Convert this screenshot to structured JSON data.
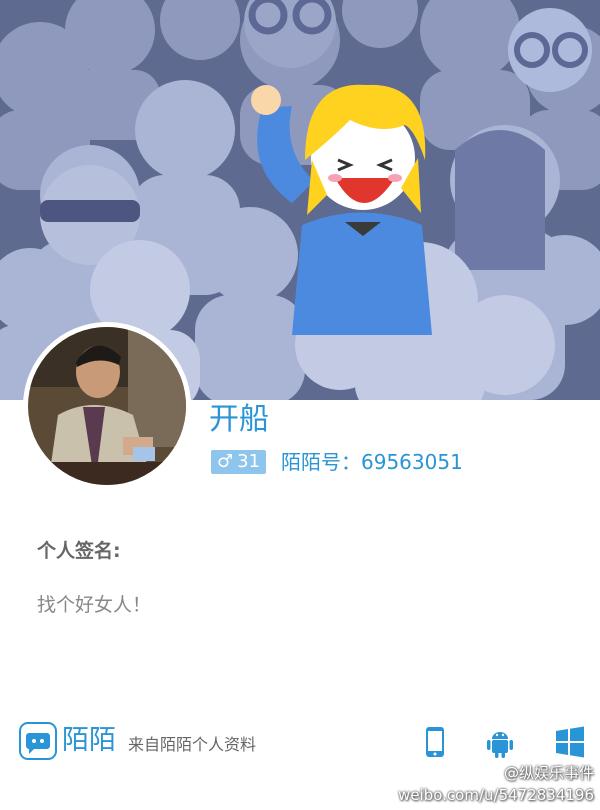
{
  "profile": {
    "name": "开船",
    "gender_symbol": "♂",
    "age": "31",
    "momo_id_label": "陌陌号：",
    "momo_id": "69563051"
  },
  "signature": {
    "title": "个人签名:",
    "text": "找个好女人！"
  },
  "footer": {
    "brand": "陌陌",
    "note": "来自陌陌个人资料",
    "platforms": [
      "phone-icon",
      "android-icon",
      "windows-icon"
    ],
    "accent_color": "#2a95d6"
  },
  "watermark": {
    "handle": "@纵娱乐事件",
    "url": "weibo.com/u/5472834196"
  },
  "colors": {
    "banner_bg": "#5e6a90",
    "accent": "#2a95d6",
    "badge": "#8dc5ec"
  }
}
